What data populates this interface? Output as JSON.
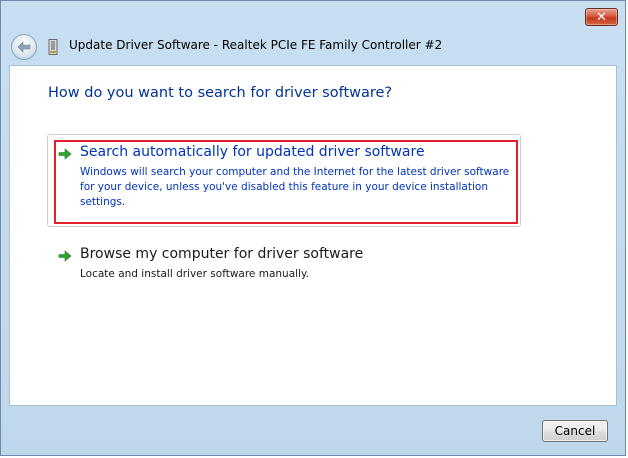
{
  "window": {
    "title": "Update Driver Software - Realtek PCIe FE Family Controller #2",
    "close_label": "✕"
  },
  "dialog": {
    "heading": "How do you want to search for driver software?",
    "options": [
      {
        "title": "Search automatically for updated driver software",
        "description": "Windows will search your computer and the Internet for the latest driver software for your device, unless you've disabled this feature in your device installation settings."
      },
      {
        "title": "Browse my computer for driver software",
        "description": "Locate and install driver software manually."
      }
    ]
  },
  "footer": {
    "cancel_label": "Cancel"
  },
  "icons": {
    "back": "back-arrow-icon",
    "device": "network-adapter-icon",
    "option_arrow": "green-arrow-icon"
  },
  "colors": {
    "accent_text": "#0033bb",
    "heading_text": "#003399",
    "highlight_border": "#e0202a",
    "arrow_green": "#2fa52f"
  }
}
